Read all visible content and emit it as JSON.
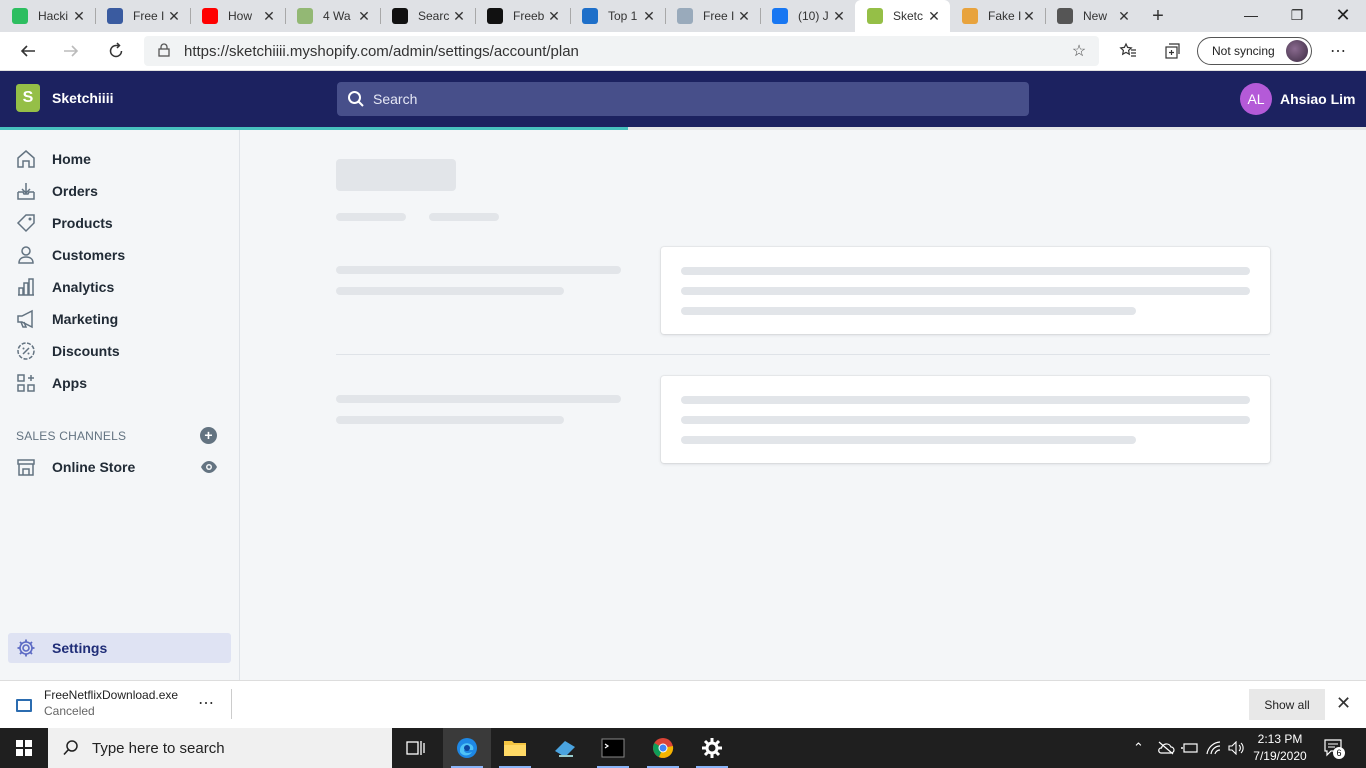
{
  "browser": {
    "tabs": [
      {
        "title": "Hacki",
        "icon": "evernote-icon",
        "color": "#2dbe60"
      },
      {
        "title": "Free I",
        "icon": "shield-icon",
        "color": "#3a5ba0"
      },
      {
        "title": "How",
        "icon": "youtube-icon",
        "color": "#ff0000"
      },
      {
        "title": "4 Wa",
        "icon": "wikihow-icon",
        "color": "#93b874"
      },
      {
        "title": "Searc",
        "icon": "bm-icon",
        "color": "#111111"
      },
      {
        "title": "Freeb",
        "icon": "bm-icon",
        "color": "#111111"
      },
      {
        "title": "Top 1",
        "icon": "b-icon",
        "color": "#1e6fc9"
      },
      {
        "title": "Free I",
        "icon": "page-icon",
        "color": "#9ab"
      },
      {
        "title": "(10) J",
        "icon": "facebook-icon",
        "color": "#1877f2"
      },
      {
        "title": "Sketc",
        "icon": "shopify-icon",
        "color": "#95bf47",
        "active": true
      },
      {
        "title": "Fake I",
        "icon": "colorful-icon",
        "color": "#e8a33d"
      },
      {
        "title": "New",
        "icon": "newtab-icon",
        "color": "#555555"
      }
    ],
    "url": "https://sketchiiii.myshopify.com/admin/settings/account/plan",
    "sync_label": "Not syncing"
  },
  "topbar": {
    "store_name": "Sketchiiii",
    "search_placeholder": "Search",
    "user_initials": "AL",
    "user_name": "Ahsiao Lim",
    "avatar_color": "#b45ad8",
    "bar_color": "#1c2260"
  },
  "sidebar": {
    "items": [
      {
        "label": "Home",
        "icon": "home-icon"
      },
      {
        "label": "Orders",
        "icon": "orders-icon"
      },
      {
        "label": "Products",
        "icon": "tag-icon"
      },
      {
        "label": "Customers",
        "icon": "person-icon"
      },
      {
        "label": "Analytics",
        "icon": "bar-chart-icon"
      },
      {
        "label": "Marketing",
        "icon": "megaphone-icon"
      },
      {
        "label": "Discounts",
        "icon": "discount-icon"
      },
      {
        "label": "Apps",
        "icon": "apps-icon"
      }
    ],
    "sales_channels_title": "SALES CHANNELS",
    "online_store_label": "Online Store",
    "settings_label": "Settings"
  },
  "download": {
    "filename": "FreeNetflixDownload.exe",
    "status": "Canceled",
    "show_all_label": "Show all"
  },
  "taskbar": {
    "search_placeholder": "Type here to search",
    "time": "2:13 PM",
    "date": "7/19/2020",
    "notification_count": "6"
  }
}
